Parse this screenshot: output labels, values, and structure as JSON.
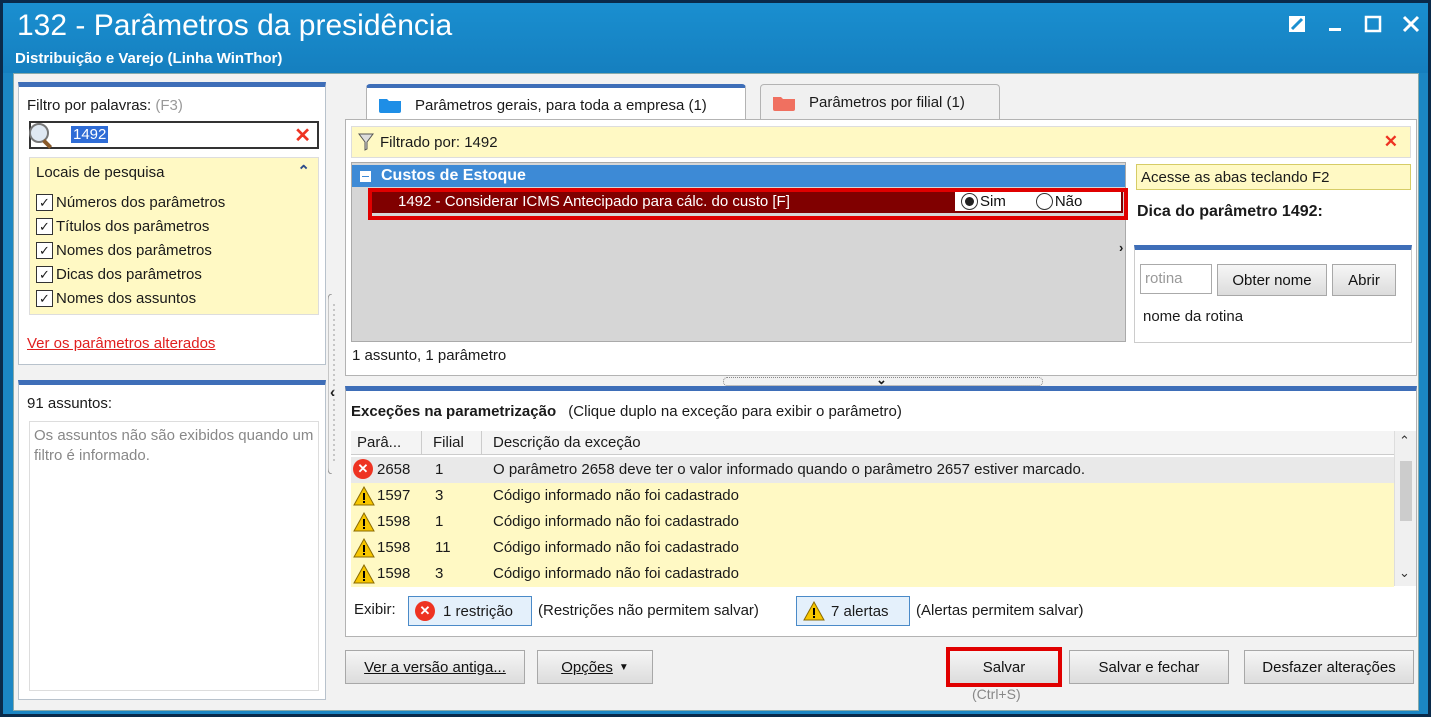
{
  "window": {
    "title": "132 - Parâmetros da presidência",
    "subtitle": "Distribuição e Varejo (Linha WinThor)"
  },
  "left": {
    "filter_label": "Filtro por palavras:",
    "filter_shortcut": "(F3)",
    "search_value": "1492",
    "locais_title": "Locais de pesquisa",
    "checks": [
      {
        "label": "Números dos parâmetros",
        "checked": true
      },
      {
        "label": "Títulos dos parâmetros",
        "checked": true
      },
      {
        "label": "Nomes dos parâmetros",
        "checked": true
      },
      {
        "label": "Dicas dos parâmetros",
        "checked": true
      },
      {
        "label": "Nomes dos assuntos",
        "checked": true
      }
    ],
    "altered_link": "Ver os parâmetros alterados",
    "assuntos_count": "91 assuntos:",
    "assuntos_hint": "Os assuntos não são exibidos quando um filtro é informado."
  },
  "tabs": [
    {
      "label": "Parâmetros gerais, para toda a empresa  (1)",
      "active": true,
      "color": "#1e8ee6"
    },
    {
      "label": "Parâmetros por filial  (1)",
      "active": false,
      "color": "#f07060"
    }
  ],
  "filter_bar": {
    "label": "Filtrado por: 1492"
  },
  "params": {
    "group": "Custos de Estoque",
    "row": "1492 - Considerar ICMS Antecipado para cálc. do custo  [F]",
    "option_yes": "Sim",
    "option_no": "Não",
    "selected": "Sim",
    "count": "1 assunto, 1 parâmetro"
  },
  "tip": {
    "access": "Acesse as abas teclando F2",
    "title": "Dica do parâmetro 1492:",
    "rotina_placeholder": "rotina",
    "obter_nome": "Obter nome",
    "abrir": "Abrir",
    "rotina_desc": "nome da rotina"
  },
  "exceptions": {
    "title": "Exceções na parametrização",
    "hint": "(Clique duplo na exceção para exibir o parâmetro)",
    "columns": [
      "Parâ...",
      "Filial",
      "Descrição da exceção"
    ],
    "rows": [
      {
        "type": "error",
        "param": "2658",
        "filial": "1",
        "desc": "O parâmetro 2658 deve ter o valor informado quando o parâmetro 2657 estiver marcado."
      },
      {
        "type": "warn",
        "param": "1597",
        "filial": "3",
        "desc": "Código informado não foi cadastrado"
      },
      {
        "type": "warn",
        "param": "1598",
        "filial": "1",
        "desc": "Código informado não foi cadastrado"
      },
      {
        "type": "warn",
        "param": "1598",
        "filial": "11",
        "desc": "Código informado não foi cadastrado"
      },
      {
        "type": "warn",
        "param": "1598",
        "filial": "3",
        "desc": "Código informado não foi cadastrado"
      }
    ],
    "exibir": "Exibir:",
    "restricao_btn": "1 restrição",
    "restricao_note": "(Restrições não permitem salvar)",
    "alertas_btn": "7 alertas",
    "alertas_note": "(Alertas permitem salvar)"
  },
  "footer": {
    "ver_versao": "Ver a versão antiga...",
    "opcoes": "Opções",
    "salvar": "Salvar",
    "salvar_shortcut": "(Ctrl+S)",
    "salvar_fechar": "Salvar e fechar",
    "desfazer": "Desfazer alterações"
  },
  "colors": {
    "accent": "#3e6eb8",
    "title_bar": "#1a8fd0",
    "selected_row": "#800000",
    "highlight": "#e00000",
    "yellow_bg": "#fff9c4"
  }
}
